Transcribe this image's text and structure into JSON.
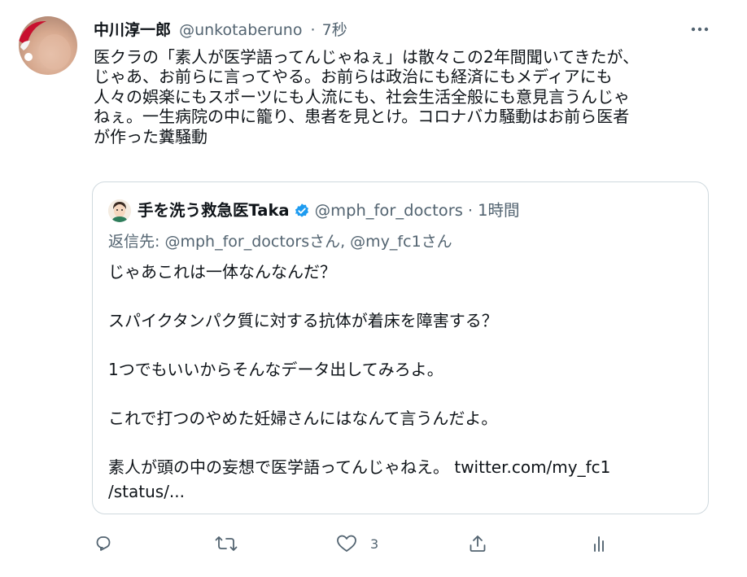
{
  "tweet": {
    "display_name": "中川淳一郎",
    "handle": "@unkotaberuno",
    "separator": "·",
    "time": "7秒",
    "text": "医クラの「素人が医学語ってんじゃねぇ」は散々この2年間聞いてきたが、\nじゃあ、お前らに言ってやる。お前らは政治にも経済にもメディアにも\n人々の娯楽にもスポーツにも人流にも、社会生活全般にも意見言うんじゃ\nねぇ。一生病院の中に籠り、患者を見とけ。コロナバカ騒動はお前ら医者\nが作った糞騒動"
  },
  "quote": {
    "display_name": "手を洗う救急医Taka",
    "handle": "@mph_for_doctors",
    "separator": "·",
    "time": "1時間",
    "reply_prefix": "返信先: ",
    "reply_mentions": "@mph_for_doctorsさん, @my_fc1さん",
    "text": "じゃあこれは一体なんなんだ？\n\nスパイクタンパク質に対する抗体が着床を障害する？\n\n1つでもいいからそんなデータ出してみろよ。\n\nこれで打つのやめた妊婦さんにはなんて言うんだよ。\n\n素人が頭の中の妄想で医学語ってんじゃねえ。 twitter.com/my_fc1\n/status/..."
  },
  "actions": {
    "reply_icon": "reply-icon",
    "retweet_icon": "retweet-icon",
    "like_icon": "like-icon",
    "like_count": "3",
    "share_icon": "share-icon",
    "analytics_icon": "analytics-icon"
  },
  "colors": {
    "text_primary": "#0f1419",
    "text_secondary": "#536471",
    "border": "#cfd9de",
    "verified_blue": "#1d9bf0"
  }
}
